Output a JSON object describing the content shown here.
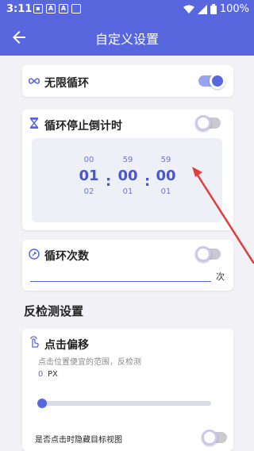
{
  "status": {
    "time": "3:11",
    "battery": "100%"
  },
  "appbar": {
    "title": "自定义设置"
  },
  "infinite_loop": {
    "label": "无限循环",
    "enabled": true
  },
  "loop_countdown": {
    "label": "循环停止倒计时",
    "enabled": false,
    "timer": {
      "hours": {
        "above": "00",
        "current": "01",
        "below": "02"
      },
      "minutes": {
        "above": "59",
        "current": "00",
        "below": "01"
      },
      "seconds": {
        "above": "59",
        "current": "00",
        "below": "01"
      },
      "separator": ":"
    }
  },
  "loop_count": {
    "label": "循环次数",
    "enabled": false,
    "unit": "次"
  },
  "anti_detect": {
    "section_title": "反检测设置",
    "click_offset": {
      "label": "点击偏移",
      "hint": "点击位置便宜的范围，反检测",
      "value": "0",
      "unit": "PX",
      "slider_value": 0
    },
    "hide_target_view": {
      "label": "是否点击时隐藏目标视图",
      "enabled": false
    }
  }
}
